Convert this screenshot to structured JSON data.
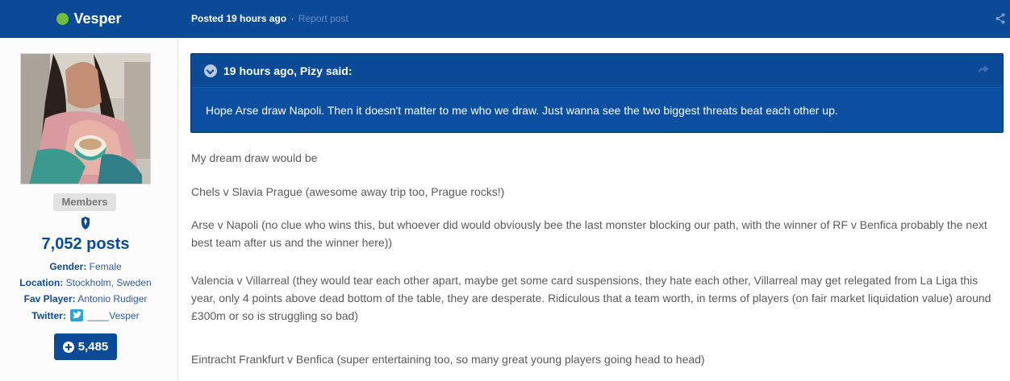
{
  "author": {
    "name": "Vesper",
    "online": true,
    "group": "Members",
    "post_count": "7,052 posts",
    "gender_label": "Gender:",
    "gender": "Female",
    "location_label": "Location:",
    "location": "Stockholm, Sweden",
    "fav_label": "Fav Player:",
    "fav_player": "Antonio Rudiger",
    "twitter_label": "Twitter:",
    "twitter": "____Vesper",
    "reputation": "5,485"
  },
  "post_meta": {
    "posted": "Posted",
    "time": "19 hours ago",
    "separator": "·",
    "report": "Report post"
  },
  "quote": {
    "header": "19 hours ago, Pizy said:",
    "text": "Hope Arse draw Napoli. Then it doesn't matter to me who we draw. Just wanna see the two biggest threats beat each other up."
  },
  "content": {
    "paragraphs": [
      "My dream draw would be",
      "Chels v Slavia Prague (awesome away trip too, Prague rocks!)",
      "Arse v Napoli (no clue who wins this, but whoever did would obviously bee the last monster blocking our path, with the winner of RF v Benfica probably the next best team after us and the winner here))",
      "Valencia v Villarreal (they would tear each other apart, maybe get some card suspensions, they hate each other, Villarreal may get relegated from La Liga this year, only 4 points above dead bottom of the table, they are desperate. Ridiculous that a team worth, in terms of players (on fair market liquidation value) around £300m or so is struggling so bad)",
      "Eintracht Frankfurt v Benfica (super entertaining too, so many great young players going head to head)"
    ]
  },
  "colors": {
    "brand_blue": "#0a4a96",
    "online_green": "#6fbf3b",
    "twitter_blue": "#2aa3d8"
  },
  "icons": [
    "online-status-icon",
    "share-icon",
    "chelsea-crest-icon",
    "twitter-icon",
    "plus-icon",
    "chevron-down-icon",
    "quote-share-icon"
  ]
}
